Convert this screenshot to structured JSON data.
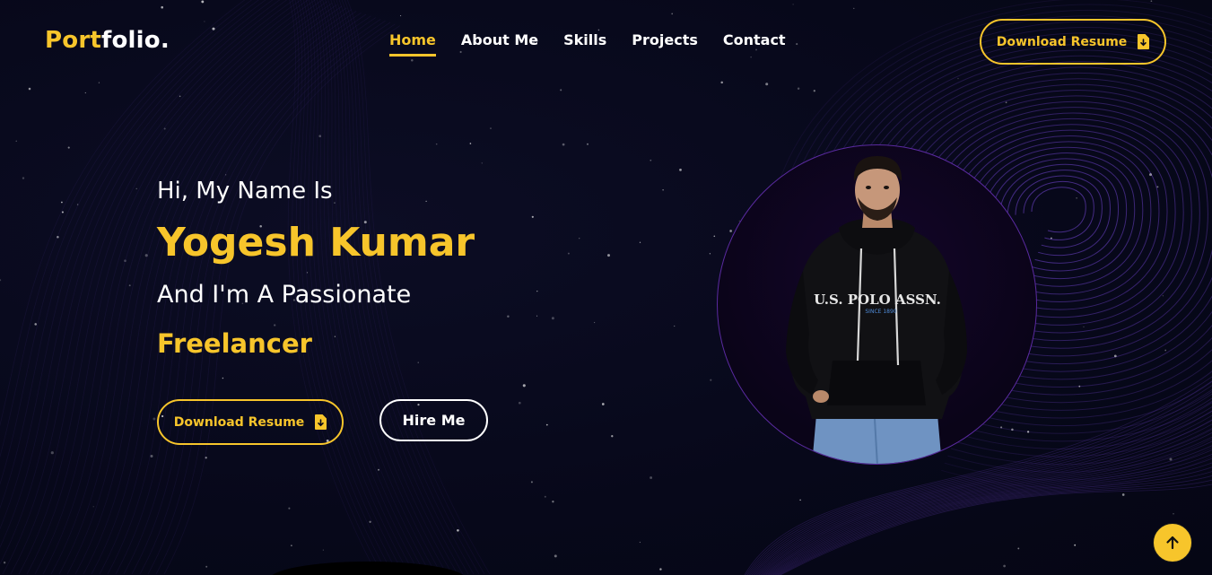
{
  "brand": {
    "part1": "Port",
    "part2": "folio."
  },
  "nav": {
    "items": [
      {
        "label": "Home",
        "active": true
      },
      {
        "label": "About Me"
      },
      {
        "label": "Skills"
      },
      {
        "label": "Projects"
      },
      {
        "label": "Contact"
      }
    ],
    "download_label": "Download Resume"
  },
  "hero": {
    "greeting": "Hi, My Name Is",
    "name": "Yogesh Kumar",
    "tagline": "And I'm A Passionate",
    "role": "Freelancer",
    "download_label": "Download Resume",
    "hire_label": "Hire Me"
  },
  "portrait": {
    "hoodie_text": "U.S. POLO ASSN.",
    "hoodie_subtext": "SINCE 1890"
  },
  "icons": {
    "file": "file-download-icon",
    "scroll": "arrow-up-icon"
  },
  "colors": {
    "accent": "#f7c52b",
    "background": "#07081a",
    "ring": "#5a2aa0",
    "lines": "#7a4ae0"
  }
}
